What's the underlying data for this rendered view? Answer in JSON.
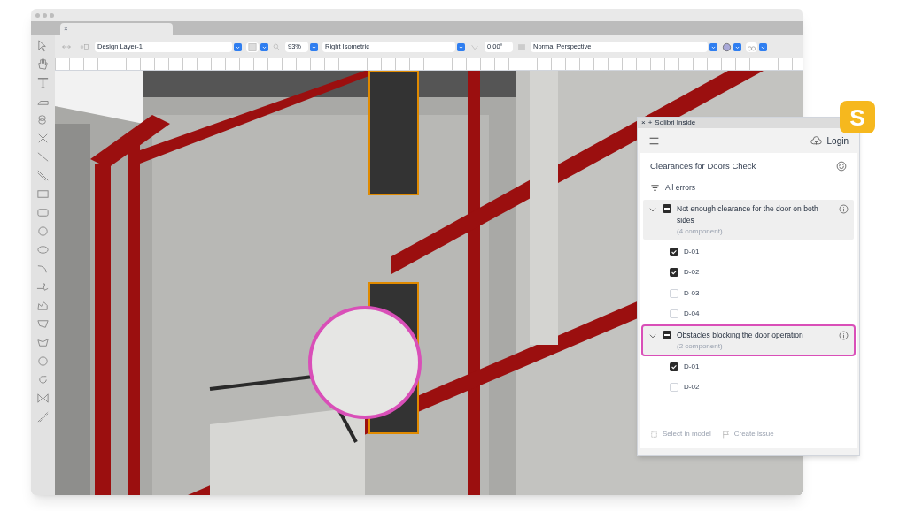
{
  "window": {
    "tab_close": "×"
  },
  "toolbar": {
    "layer": "Design Layer-1",
    "zoom": "93%",
    "view": "Right Isometric",
    "angle": "0.00°",
    "projection": "Normal Perspective"
  },
  "panel": {
    "close": "×",
    "add": "+",
    "title": "Solibri Inside",
    "login": "Login",
    "check_title": "Clearances for Doors Check",
    "filter": "All errors",
    "groups": [
      {
        "title": "Not enough clearance for the door on both sides",
        "count": "(4 component)",
        "expanded": true,
        "highlighted": false,
        "items": [
          {
            "label": "D-01",
            "checked": true
          },
          {
            "label": "D-02",
            "checked": true
          },
          {
            "label": "D-03",
            "checked": false
          },
          {
            "label": "D-04",
            "checked": false
          }
        ]
      },
      {
        "title": "Obstacles blocking the door operation",
        "count": "(2 component)",
        "expanded": true,
        "highlighted": true,
        "items": [
          {
            "label": "D-01",
            "checked": true
          },
          {
            "label": "D-02",
            "checked": false
          }
        ]
      }
    ],
    "actions": [
      {
        "kind": "select",
        "label": "Select in model",
        "disabled": true
      },
      {
        "kind": "issue",
        "label": "Create issue",
        "disabled": true
      }
    ]
  },
  "logo": {
    "letter": "S"
  }
}
